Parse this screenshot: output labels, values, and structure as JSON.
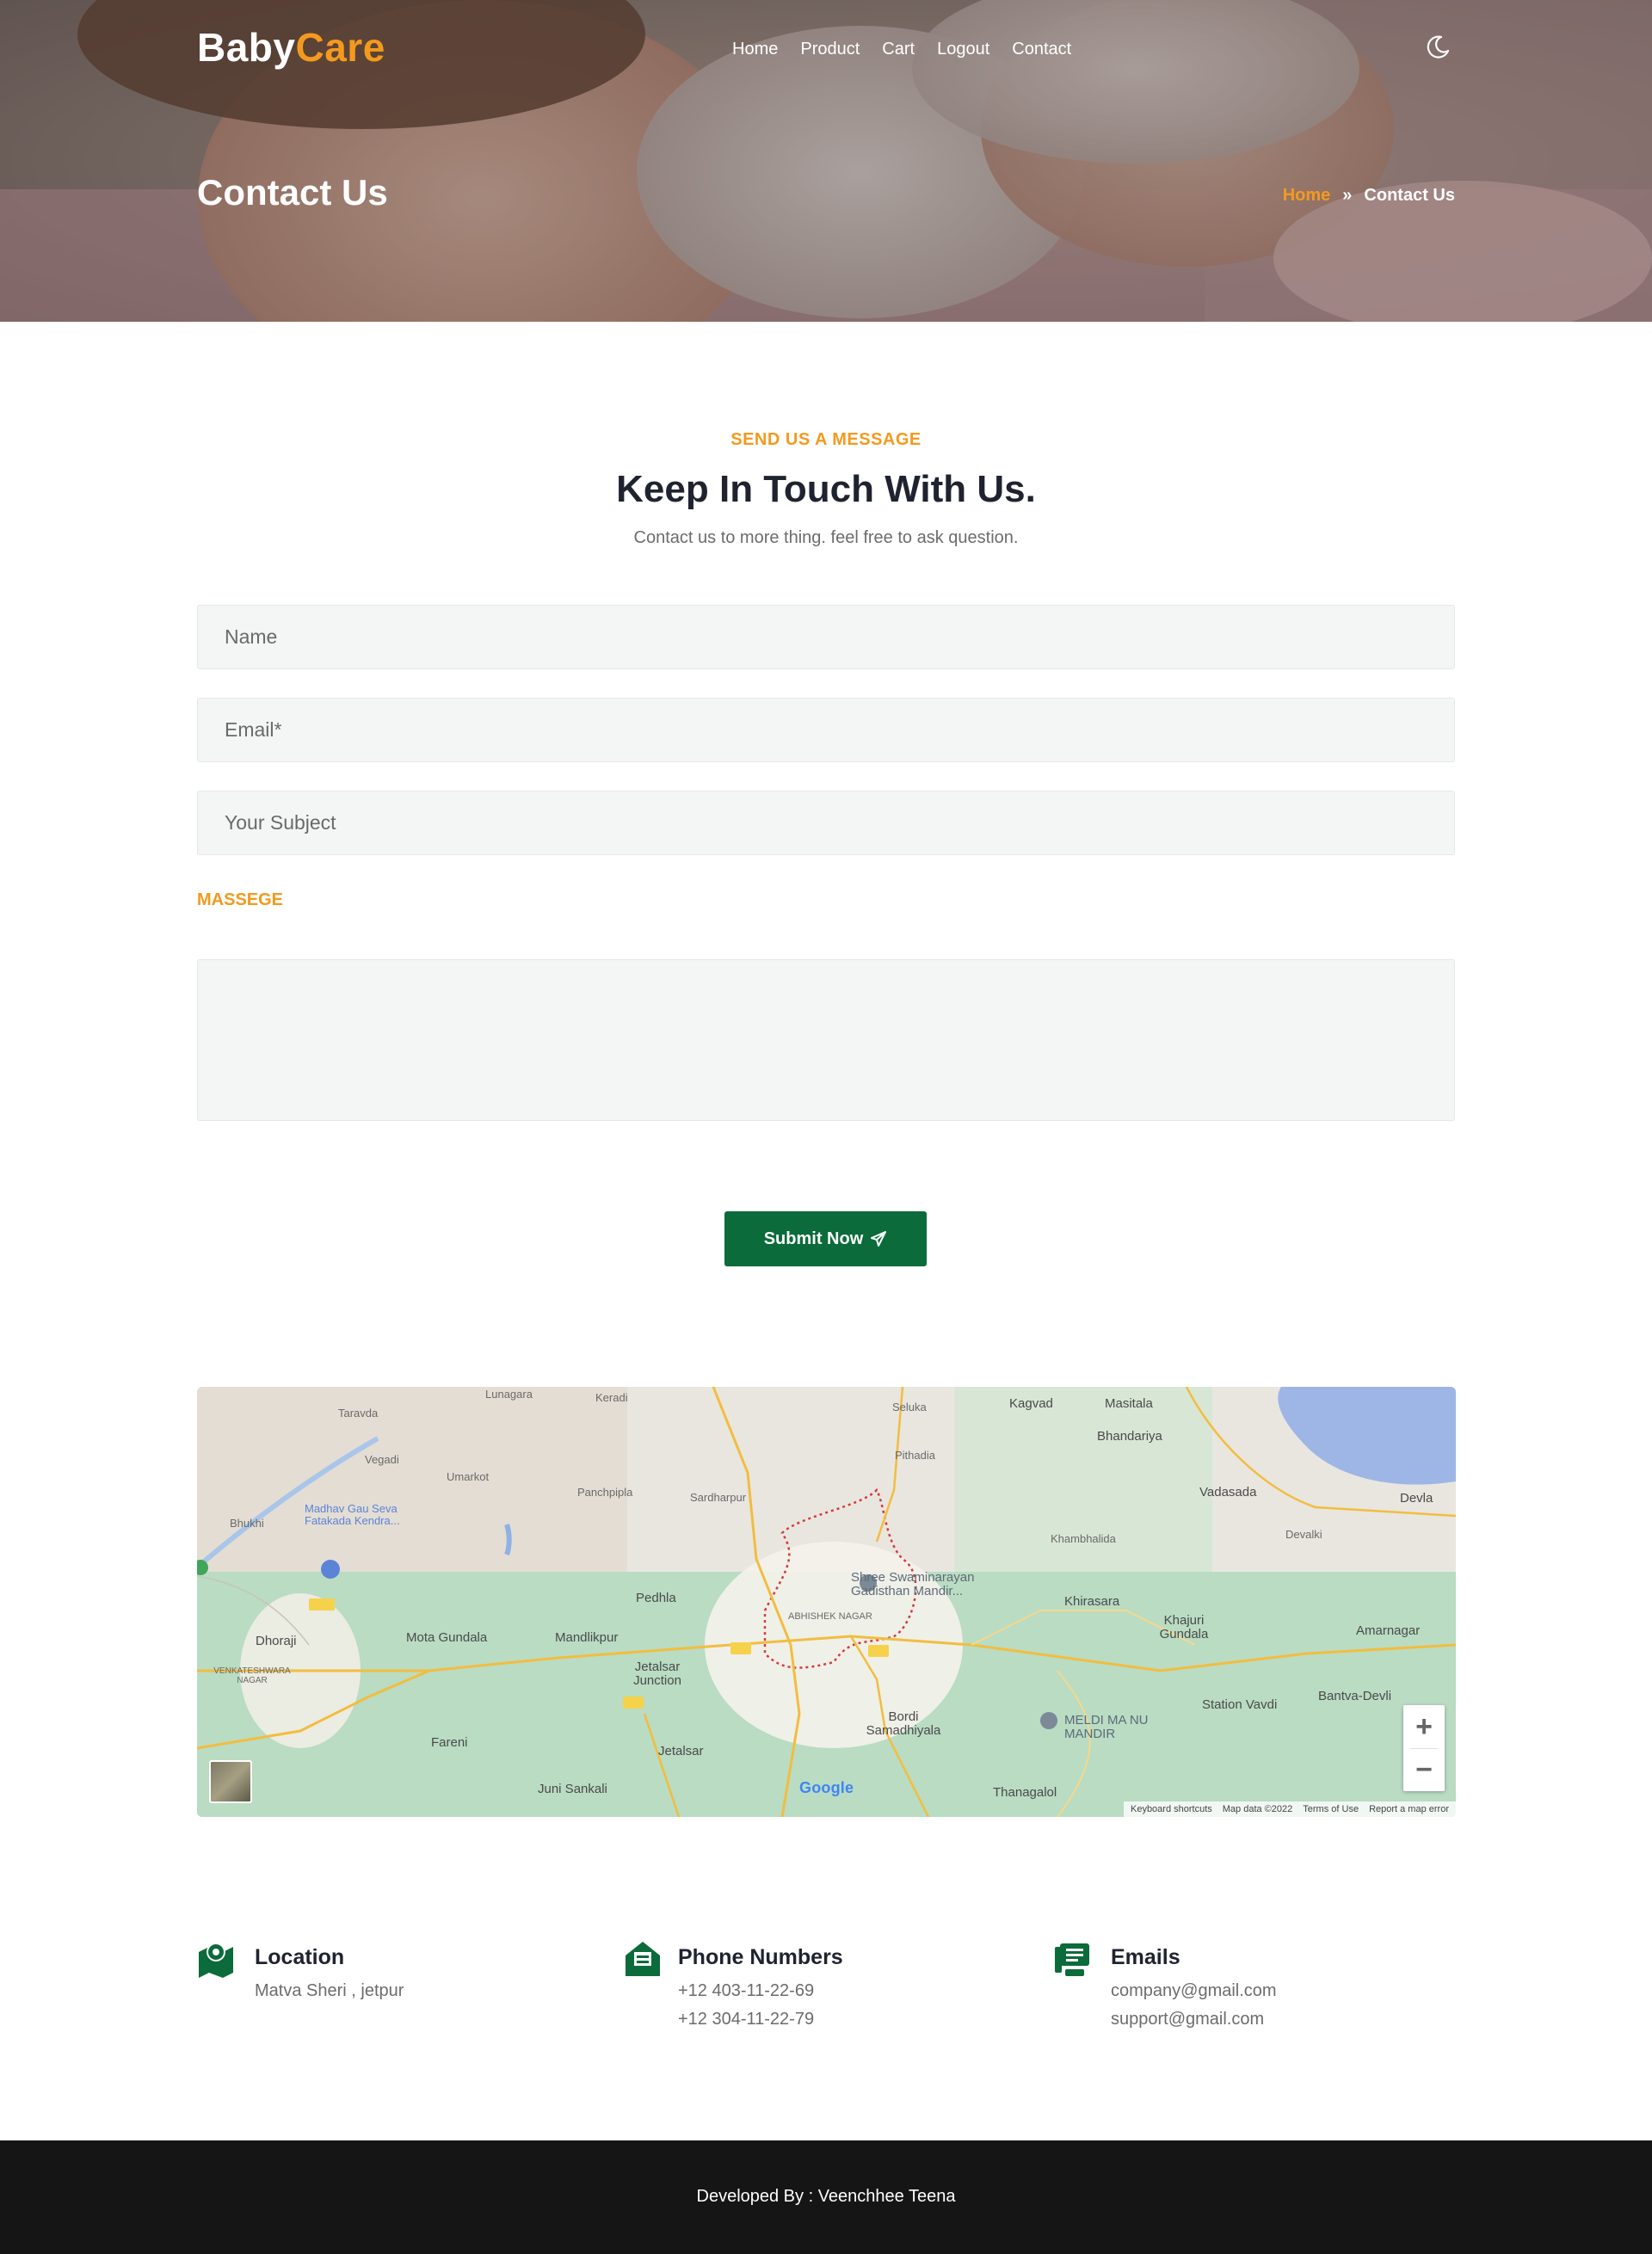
{
  "brand": {
    "part1": "Baby",
    "part2": "Care"
  },
  "nav": {
    "items": [
      "Home",
      "Product",
      "Cart",
      "Logout",
      "Contact"
    ]
  },
  "theme_toggle": {
    "icon": "moon-icon"
  },
  "hero": {
    "title": "Contact Us",
    "breadcrumb_home": "Home",
    "breadcrumb_sep": "»",
    "breadcrumb_current": "Contact Us"
  },
  "contact": {
    "kicker": "SEND US A MESSAGE",
    "headline": "Keep In Touch With Us.",
    "subline": "Contact us to more thing. feel free to ask question.",
    "name_placeholder": "Name",
    "email_placeholder": "Email*",
    "subject_placeholder": "Your Subject",
    "message_label": "MASSEGE",
    "submit_label": "Submit Now"
  },
  "map": {
    "labels": [
      "Lunagara",
      "Keradi",
      "Seluka",
      "Kagvad",
      "Masitala",
      "Taravda",
      "Vegadi",
      "Umarkot",
      "Panchpipla",
      "Sardharpur",
      "Pithadia",
      "Bhandariya",
      "Vadasada",
      "Devla",
      "Bhukhi",
      "Madhav Gau Seva Fatakada Kendra...",
      "Khambhalida",
      "Devalki",
      "Shree Swaminarayan Gadisthan Mandir...",
      "Pedhla",
      "Khirasara",
      "Khajuri Gundala",
      "Amarnagar",
      "Dhoraji",
      "Mota Gundala",
      "Mandlikpur",
      "ABHISHEK NAGAR",
      "Jetalsar Junction",
      "Bordi Samadhiyala",
      "MELDI MA NU MANDIR",
      "Station Vavdi",
      "Bantva-Devli",
      "VENKATESHWARA NAGAR",
      "Fareni",
      "Jetalsar",
      "Juni Sankali",
      "Thanagalol"
    ],
    "google": "Google",
    "footer_keyboard": "Keyboard shortcuts",
    "footer_mapdata": "Map data ©2022",
    "footer_terms": "Terms of Use",
    "footer_report": "Report a map error",
    "zoom_in": "+",
    "zoom_out": "−"
  },
  "info": {
    "location_title": "Location",
    "location_line": "Matva Sheri , jetpur",
    "phone_title": "Phone Numbers",
    "phone_1": "+12 403-11-22-69",
    "phone_2": "+12 304-11-22-79",
    "email_title": "Emails",
    "email_1": "company@gmail.com",
    "email_2": "support@gmail.com"
  },
  "footer": {
    "text": "Developed By : Veenchhee Teena"
  },
  "colors": {
    "accent": "#f39a1e",
    "primary_green": "#0b6b3a",
    "footer_bg": "#151515"
  }
}
